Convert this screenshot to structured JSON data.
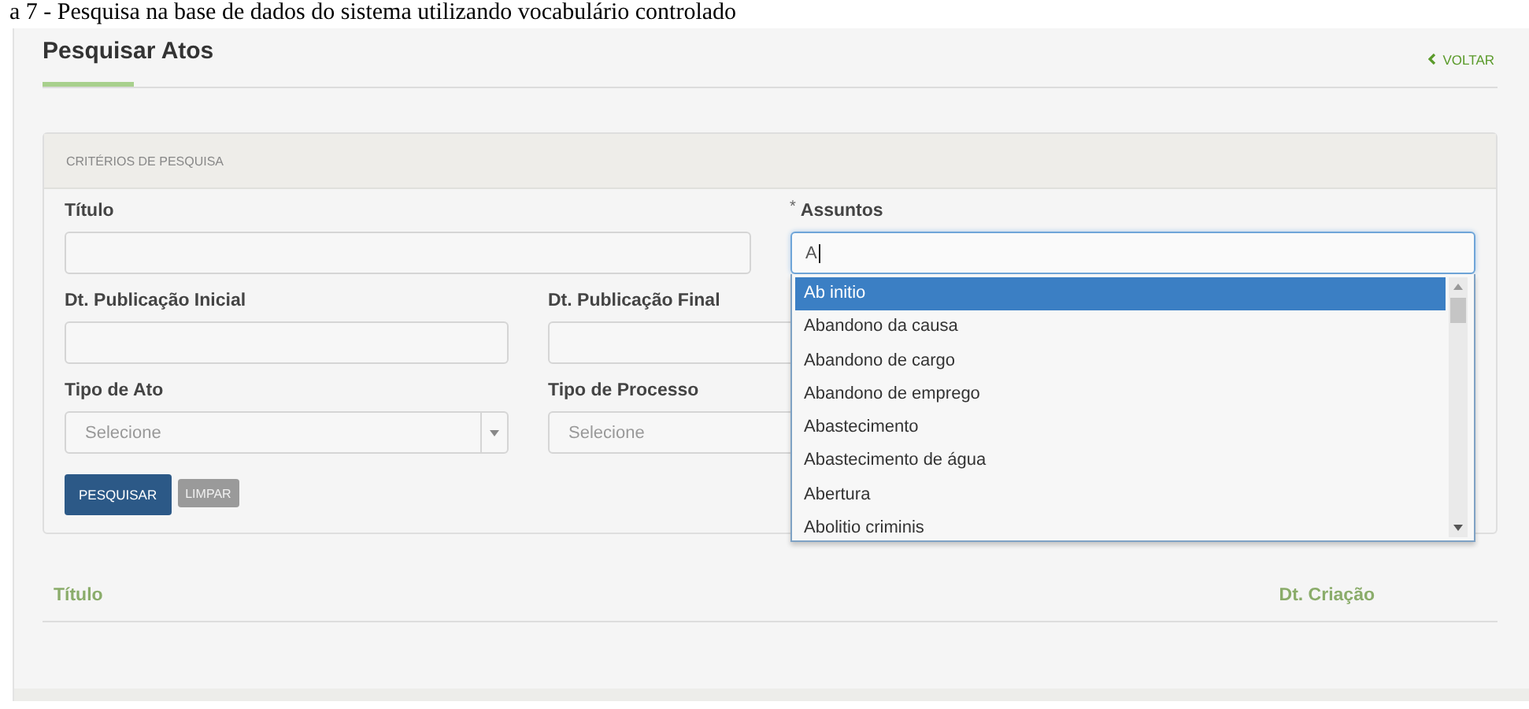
{
  "caption": "a 7 - Pesquisa na base de dados do sistema utilizando vocabulário controlado",
  "page": {
    "title": "Pesquisar Atos",
    "back_link": "VOLTAR"
  },
  "criteria": {
    "heading": "CRITÉRIOS DE PESQUISA",
    "fields": [
      {
        "label": "Título",
        "kind": "text"
      },
      {
        "label": "Assuntos",
        "kind": "autocomplete",
        "required_mark": "*",
        "value": "A"
      },
      {
        "label": "Dt. Publicação Inicial",
        "kind": "text"
      },
      {
        "label": "Dt. Publicação Final",
        "kind": "text"
      },
      {
        "label": "Tipo de Ato",
        "kind": "select",
        "placeholder": "Selecione"
      },
      {
        "label": "Tipo de Processo",
        "kind": "select",
        "placeholder": "Selecione"
      }
    ],
    "buttons": [
      {
        "label": "PESQUISAR",
        "kind": "primary"
      },
      {
        "label": "LIMPAR",
        "kind": "secondary"
      }
    ]
  },
  "suggestions": [
    {
      "label": "Ab initio",
      "selected": true
    },
    {
      "label": "Abandono da causa",
      "selected": false
    },
    {
      "label": "Abandono de cargo",
      "selected": false
    },
    {
      "label": "Abandono de emprego",
      "selected": false
    },
    {
      "label": "Abastecimento",
      "selected": false
    },
    {
      "label": "Abastecimento de água",
      "selected": false
    },
    {
      "label": "Abertura",
      "selected": false
    },
    {
      "label": "Abolitio criminis",
      "selected": false
    }
  ],
  "table": {
    "columns": [
      "Título",
      "Dt. Criação"
    ]
  }
}
